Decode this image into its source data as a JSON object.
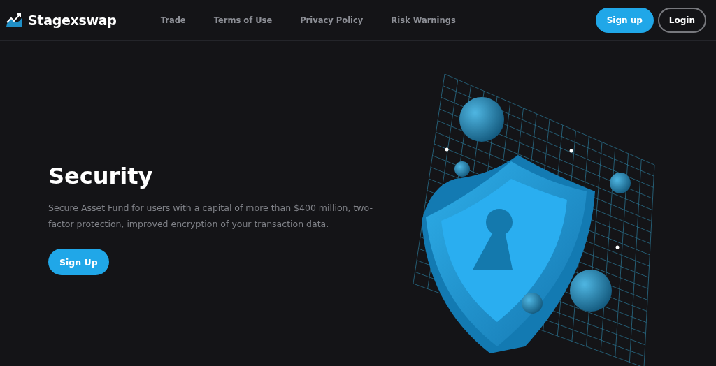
{
  "header": {
    "logo": {
      "text": "Stagexswap"
    },
    "nav": [
      {
        "label": "Trade"
      },
      {
        "label": "Terms of Use"
      },
      {
        "label": "Privacy Policy"
      },
      {
        "label": "Risk Warnings"
      }
    ],
    "actions": [
      {
        "label": "Sign up",
        "kind": "primary"
      },
      {
        "label": "Login",
        "kind": "outline"
      }
    ]
  },
  "hero": {
    "title": "Security",
    "description": "Secure Asset Fund for users with a capital of more than $400 million, two-factor protection, improved encryption of your transaction data.",
    "button": "Sign Up"
  }
}
